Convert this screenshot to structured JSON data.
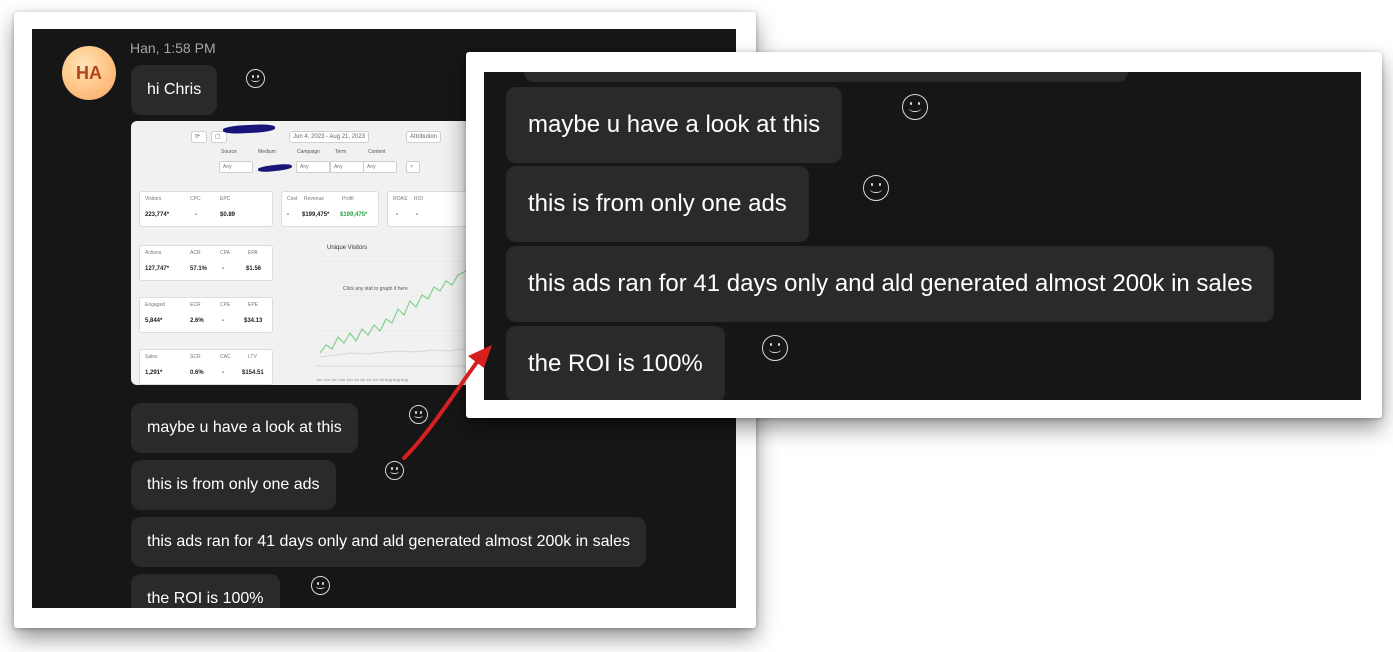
{
  "conversation": {
    "sender_initials": "HA",
    "sender_meta": "Han, 1:58 PM",
    "messages": [
      "hi Chris",
      "maybe u have a look at this",
      "this is from only one ads",
      "this ads ran for 41 days only and ald generated almost 200k in sales",
      "the ROI is 100%"
    ]
  },
  "zoom_messages": [
    "maybe u have a look at this",
    "this is from only one ads",
    "this ads ran for 41 days only and ald generated almost 200k in sales",
    "the ROI is 100%"
  ],
  "dashboard": {
    "date_range": "Jun 4, 2023 - Aug 21, 2023",
    "attribution": "Attribution",
    "filters": [
      "Source",
      "Medium",
      "Campaign",
      "Term",
      "Content"
    ],
    "filter_value": "Any",
    "chart_title": "Unique Visitors",
    "chart_hint": "Click any stat to graph it here",
    "metrics": [
      {
        "labels": [
          "Visitors",
          "CPC",
          "EPC"
        ],
        "values": [
          "223,774*",
          "-",
          "$0.89"
        ]
      },
      {
        "labels": [
          "Cost",
          "Revenue",
          "Profit"
        ],
        "values": [
          "-",
          "$199,475*",
          "$199,475*"
        ]
      },
      {
        "labels": [
          "ROAS",
          "ROI"
        ],
        "values": [
          "-",
          "-"
        ]
      },
      {
        "labels": [
          "Actions",
          "ACR",
          "CPA",
          "EPA"
        ],
        "values": [
          "127,747*",
          "57.1%",
          "-",
          "$1.56"
        ]
      },
      {
        "labels": [
          "Engaged",
          "ECR",
          "CPE",
          "EPE"
        ],
        "values": [
          "5,844*",
          "2.6%",
          "-",
          "$34.13"
        ]
      },
      {
        "labels": [
          "Sales",
          "SCR",
          "CAC",
          "LTV"
        ],
        "values": [
          "1,291*",
          "0.6%",
          "-",
          "$154.51"
        ]
      }
    ]
  },
  "colors": {
    "chat_bg": "#161617",
    "bubble": "#2a2a2c",
    "arrow": "#d62020",
    "avatar": "#ffc98b",
    "chart_line": "#7fd18b"
  },
  "icons": [
    "smiley-reaction-icon",
    "red-arrow"
  ]
}
